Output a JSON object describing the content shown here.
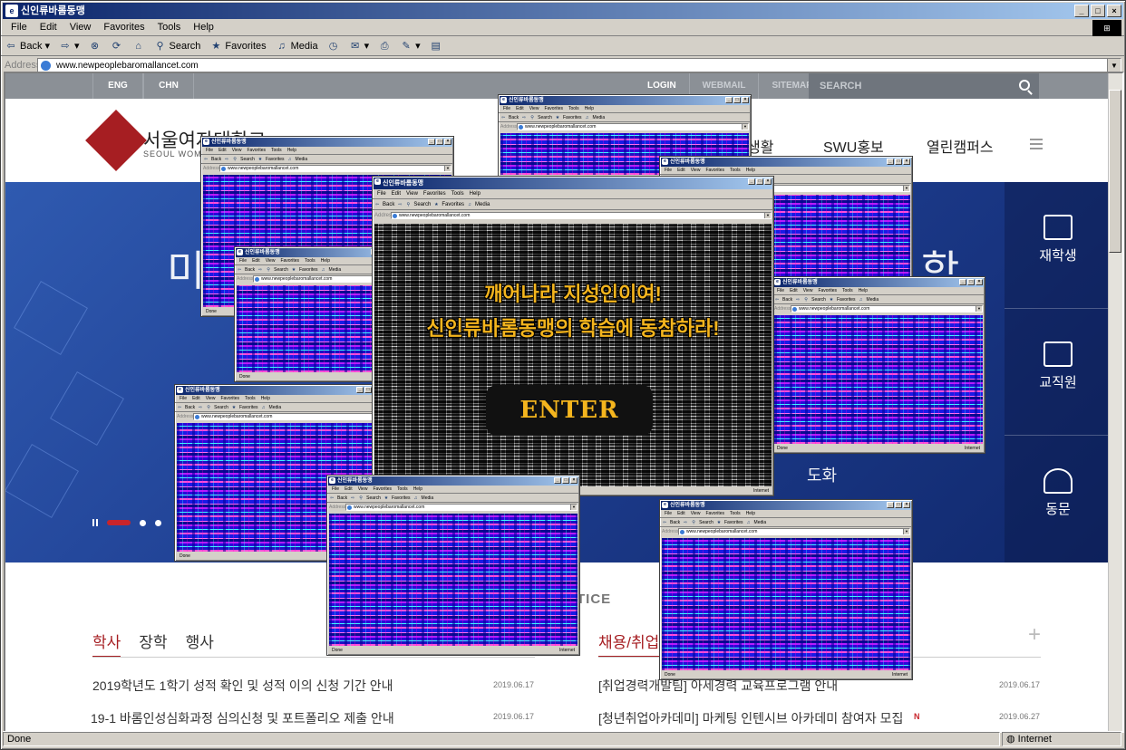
{
  "browser": {
    "title": "신인류바롬동맹",
    "menu": [
      "File",
      "Edit",
      "View",
      "Favorites",
      "Tools",
      "Help"
    ],
    "toolbar": {
      "back": "Back",
      "forward": "",
      "stop": "",
      "refresh": "",
      "home": "",
      "search": "Search",
      "favorites": "Favorites",
      "media": "Media"
    },
    "address_label": "Address",
    "address": "www.newpeoplebaromallancet.com",
    "status_left": "Done",
    "status_zone": "Internet"
  },
  "site": {
    "util_left": [
      "ENG",
      "CHN"
    ],
    "util_right": [
      "LOGIN",
      "WEBMAIL",
      "SITEMAP"
    ],
    "search_placeholder": "SEARCH",
    "logo_name": "서울여자대학교",
    "logo_sub": "SEOUL WOMEN",
    "gnb": [
      "생활",
      "SWU홍보",
      "열린캠퍼스"
    ],
    "hero_text_left": "미",
    "hero_text_right": "학",
    "hero_frag_1": "도화",
    "quick": [
      {
        "label": "재학생",
        "icon": "book-icon"
      },
      {
        "label": "교직원",
        "icon": "briefcase-icon"
      },
      {
        "label": "동문",
        "icon": "graduation-cap-icon"
      }
    ],
    "notice_heading": "TICE",
    "tabs_left": [
      "학사",
      "장학",
      "행사"
    ],
    "tabs_right": [
      "채용/취업"
    ],
    "notices_left": [
      {
        "title": "2019학년도 1학기 성적 확인 및 성적 이의 신청 기간 안내",
        "date": "2019.06.17"
      },
      {
        "title": "19-1 바롬인성심화과정 심의신청 및 포트폴리오 제출 안내",
        "date": "2019.06.17"
      }
    ],
    "notices_right": [
      {
        "title": "[취업경력개발팀] 아세경력 교육프로그램 안내",
        "date": "2019.06.17",
        "badge": ""
      },
      {
        "title": "[청년취업아카데미] 마케팅 인텐시브 아카데미 참여자 모집",
        "date": "2019.06.27",
        "badge": "N"
      }
    ]
  },
  "popup": {
    "title": "신인류바롬동맹",
    "menu": [
      "File",
      "Edit",
      "View",
      "Favorites",
      "Tools",
      "Help"
    ],
    "address": "www.newpeoplebaromallancet.com",
    "status_left": "Done",
    "status_zone": "Internet",
    "slogan_1": "깨어나라 지성인이여!",
    "slogan_2": "신인류바롬동맹의 학습에 동참하라!",
    "enter": "ENTER"
  }
}
